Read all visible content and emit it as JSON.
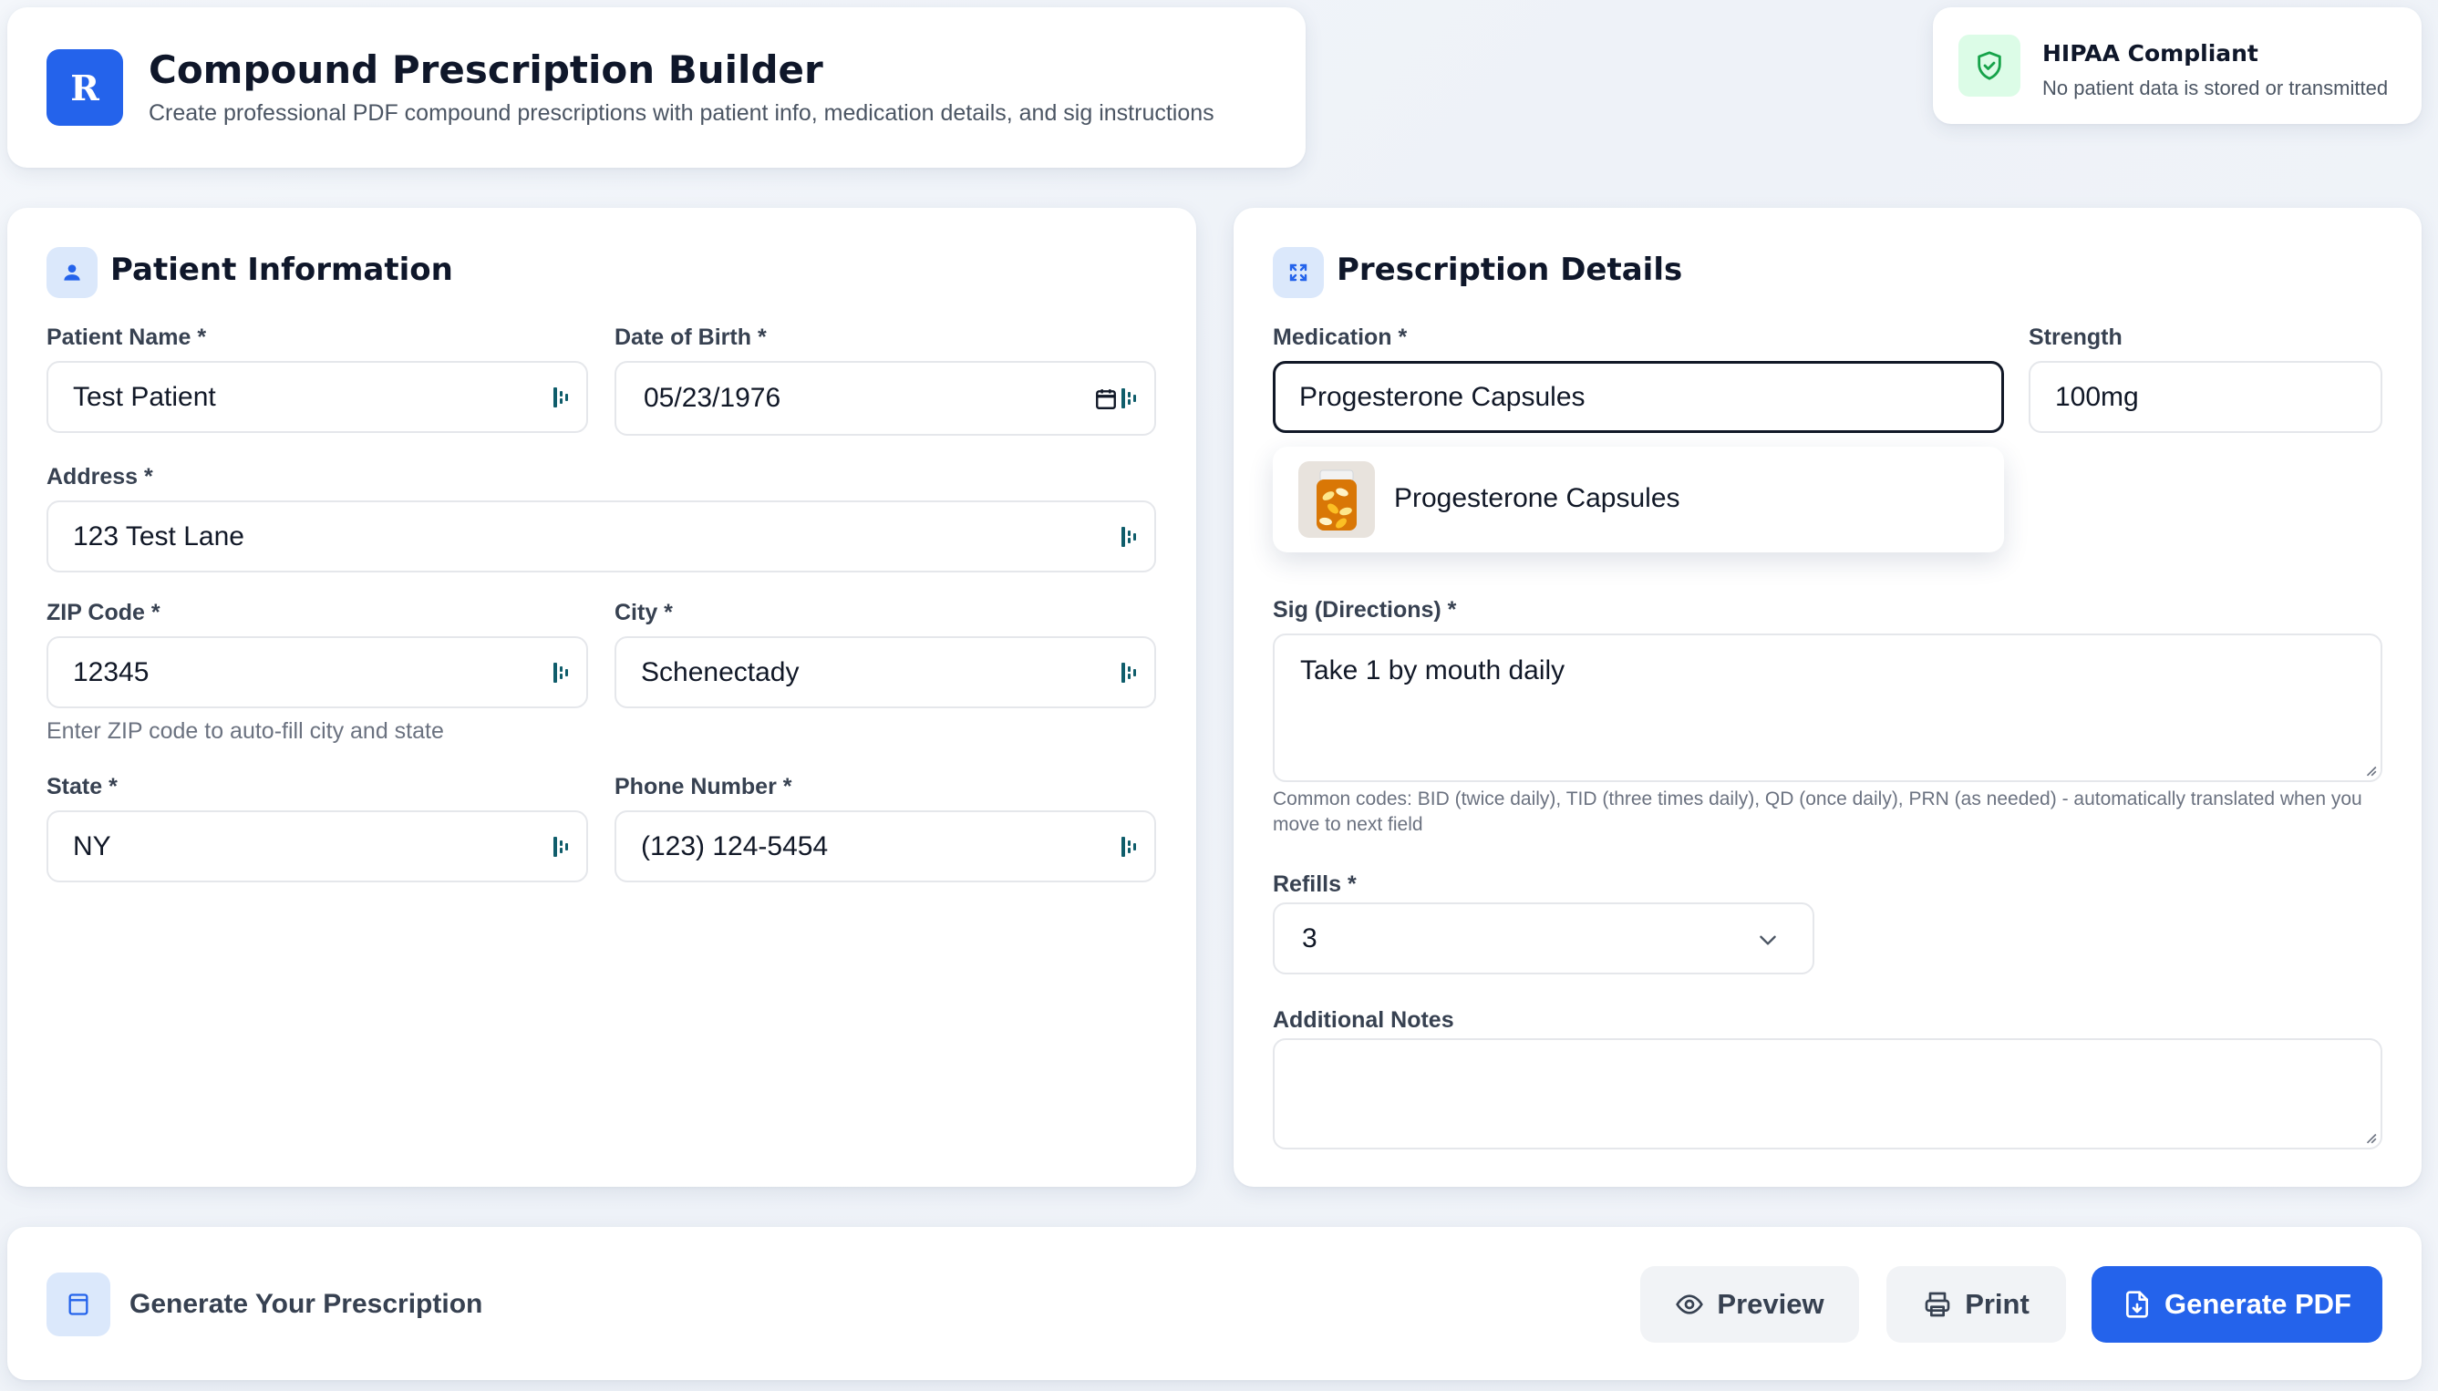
{
  "header": {
    "logo_letter": "R",
    "title": "Compound Prescription Builder",
    "subtitle": "Create professional PDF compound prescriptions with patient info, medication details, and sig instructions"
  },
  "hipaa": {
    "title": "HIPAA Compliant",
    "subtitle": "No patient data is stored or transmitted"
  },
  "patient": {
    "section_title": "Patient Information",
    "name_label": "Patient Name *",
    "name_value": "Test Patient",
    "dob_label": "Date of Birth *",
    "dob_value": "05/23/1976",
    "address_label": "Address *",
    "address_value": "123 Test Lane",
    "zip_label": "ZIP Code *",
    "zip_value": "12345",
    "zip_hint": "Enter ZIP code to auto-fill city and state",
    "city_label": "City *",
    "city_value": "Schenectady",
    "state_label": "State *",
    "state_value": "NY",
    "phone_label": "Phone Number *",
    "phone_value": "(123) 124-5454"
  },
  "prescription": {
    "section_title": "Prescription Details",
    "medication_label": "Medication *",
    "medication_value": "Progesterone Capsules",
    "strength_label": "Strength",
    "strength_value": "100mg",
    "suggestion": "Progesterone Capsules",
    "sig_label": "Sig (Directions) *",
    "sig_value": "Take 1 by mouth daily",
    "sig_hint": "Common codes: BID (twice daily), TID (three times daily), QD (once daily), PRN (as needed) - automatically translated when you move to next field",
    "refills_label": "Refills *",
    "refills_value": "3",
    "notes_label": "Additional Notes",
    "notes_value": ""
  },
  "footer": {
    "title": "Generate Your Prescription",
    "preview_label": "Preview",
    "print_label": "Print",
    "generate_label": "Generate PDF"
  },
  "colors": {
    "accent": "#2463eb",
    "success": "#16a34a"
  }
}
